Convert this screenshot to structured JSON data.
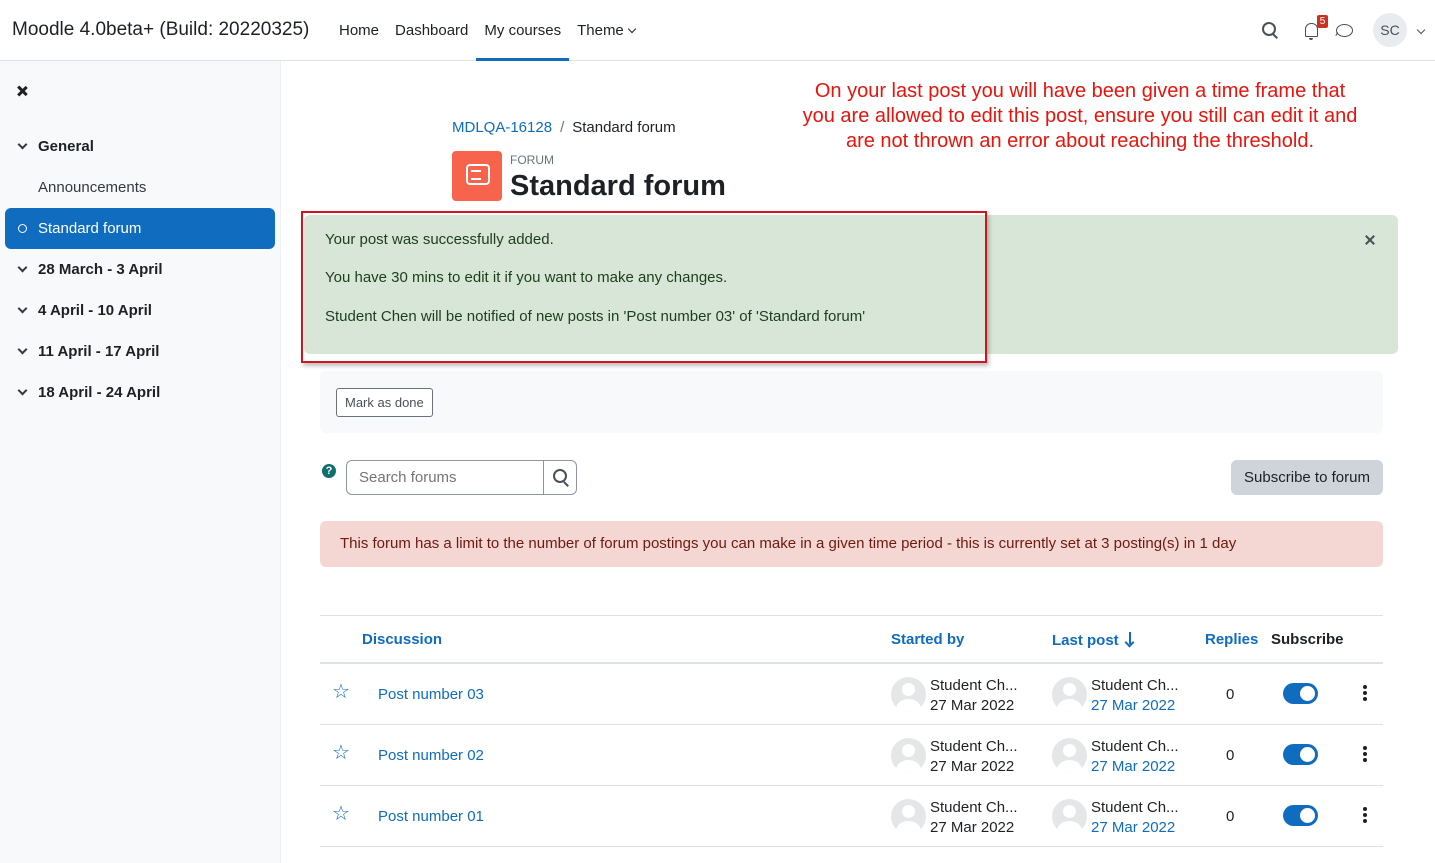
{
  "site": {
    "brand": "Moodle 4.0beta+ (Build: 20220325)"
  },
  "nav": {
    "items": [
      {
        "label": "Home",
        "active": false
      },
      {
        "label": "Dashboard",
        "active": false
      },
      {
        "label": "My courses",
        "active": true
      },
      {
        "label": "Theme",
        "active": false
      }
    ]
  },
  "user_menu": {
    "initials": "SC",
    "notification_count": "5"
  },
  "drawer": {
    "items": [
      {
        "label": "General",
        "kind": "section"
      },
      {
        "label": "Announcements",
        "kind": "sub"
      },
      {
        "label": "Standard forum",
        "kind": "active"
      },
      {
        "label": "28 March - 3 April",
        "kind": "section"
      },
      {
        "label": "4 April - 10 April",
        "kind": "section"
      },
      {
        "label": "11 April - 17 April",
        "kind": "section"
      },
      {
        "label": "18 April - 24 April",
        "kind": "section"
      }
    ]
  },
  "breadcrumb": {
    "course": "MDLQA-16128",
    "current": "Standard forum"
  },
  "header": {
    "tag": "FORUM",
    "title": "Standard forum"
  },
  "annotation": "On your last post you will have been given a time frame that you are allowed to edit this post, ensure you still can edit it and are not thrown an error about reaching the threshold.",
  "success_alert": {
    "lines": [
      "Your post was successfully added.",
      "You have 30 mins to edit it if you want to make any changes.",
      "Student Chen will be notified of new posts in 'Post number 03' of 'Standard forum'"
    ]
  },
  "completion": {
    "mark_done_label": "Mark as done"
  },
  "search": {
    "placeholder": "Search forums"
  },
  "subscribe_label": "Subscribe to forum",
  "limit_alert": "This forum has a limit to the number of forum postings you can make in a given time period - this is currently set at 3 posting(s) in 1 day",
  "table": {
    "headers": {
      "discussion": "Discussion",
      "started_by": "Started by",
      "last_post": "Last post",
      "replies": "Replies",
      "subscribe": "Subscribe"
    },
    "sort_indicator": "descending",
    "rows": [
      {
        "title": "Post number 03",
        "started_name": "Student Ch...",
        "started_date": "27 Mar 2022",
        "last_name": "Student Ch...",
        "last_date": "27 Mar 2022",
        "replies": "0",
        "subscribed": true
      },
      {
        "title": "Post number 02",
        "started_name": "Student Ch...",
        "started_date": "27 Mar 2022",
        "last_name": "Student Ch...",
        "last_date": "27 Mar 2022",
        "replies": "0",
        "subscribed": true
      },
      {
        "title": "Post number 01",
        "started_name": "Student Ch...",
        "started_date": "27 Mar 2022",
        "last_name": "Student Ch...",
        "last_date": "27 Mar 2022",
        "replies": "0",
        "subscribed": true
      }
    ]
  },
  "colors": {
    "brand_blue": "#0f6cbf",
    "forum_orange": "#f7634d",
    "annotation_red": "#e8140c",
    "success_bg": "#d7e6d6",
    "danger_bg": "#f4d6d2"
  }
}
